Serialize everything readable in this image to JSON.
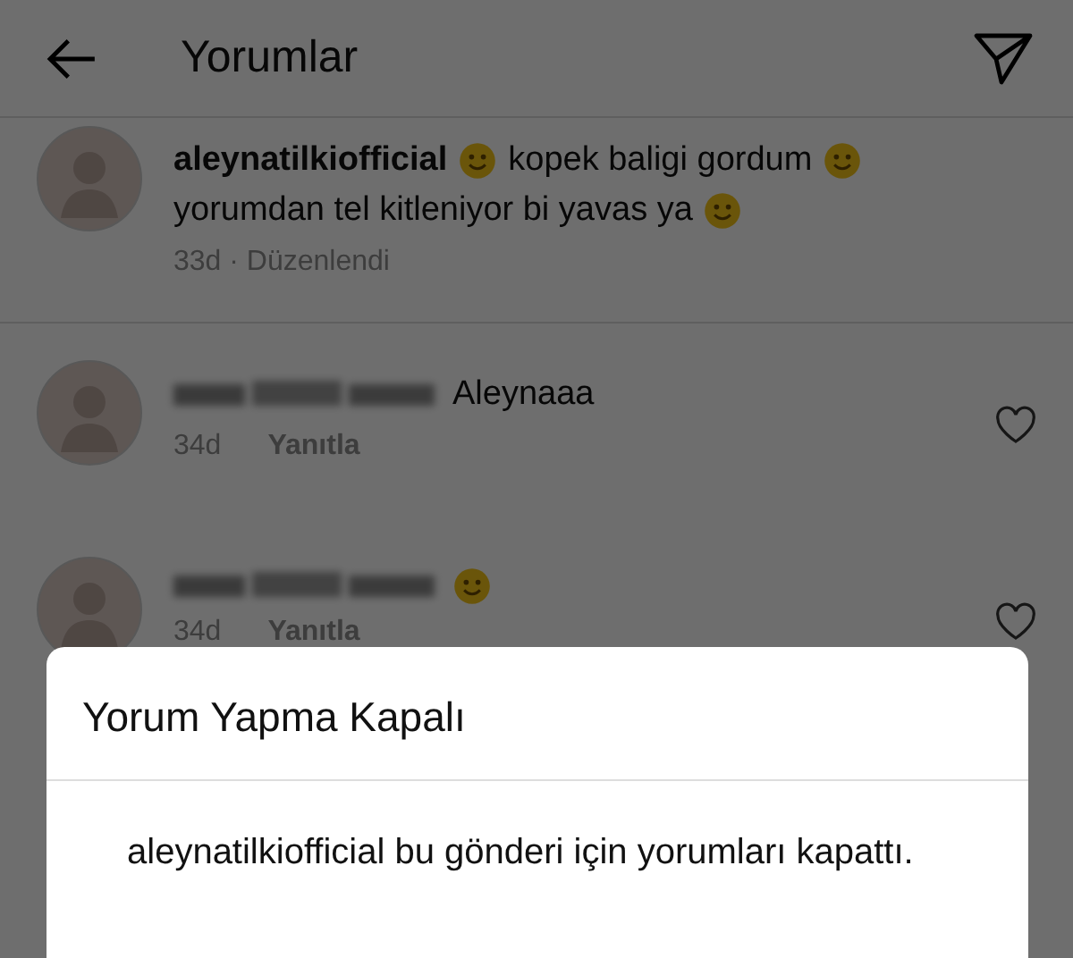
{
  "header": {
    "title": "Yorumlar"
  },
  "comments": [
    {
      "username": "aleynatilkiofficial",
      "username_hidden": false,
      "lines": [
        [
          {
            "kind": "emoji"
          },
          {
            "kind": "text",
            "text": "kopek baligi gordum"
          },
          {
            "kind": "emoji"
          }
        ],
        [
          {
            "kind": "text",
            "text": "yorumdan tel kitleniyor bi yavas ya"
          },
          {
            "kind": "emoji"
          }
        ]
      ],
      "meta": [
        {
          "kind": "plain",
          "text": "33d · Düzenlendi"
        }
      ]
    },
    {
      "username_hidden": true,
      "lines": [
        [
          {
            "kind": "text",
            "text": "Aleynaaa"
          }
        ]
      ],
      "meta": [
        {
          "kind": "plain",
          "text": "34d"
        },
        {
          "kind": "link",
          "text": "Yanıtla"
        }
      ],
      "liked": false
    },
    {
      "username_hidden": true,
      "lines": [
        [
          {
            "kind": "emoji"
          }
        ]
      ],
      "meta": [
        {
          "kind": "plain",
          "text": "34d"
        },
        {
          "kind": "link",
          "text": "Yanıtla"
        }
      ],
      "liked": false
    }
  ],
  "dialog": {
    "title": "Yorum Yapma Kapalı",
    "message": "aleynatilkiofficial bu gönderi için yorumları kapattı."
  }
}
